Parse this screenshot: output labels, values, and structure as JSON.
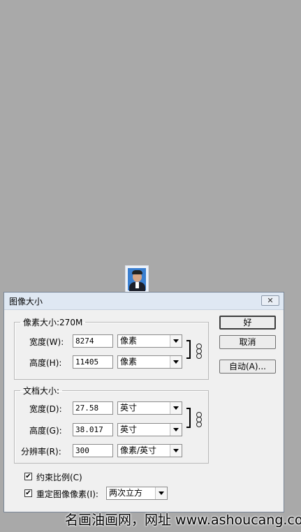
{
  "dialog": {
    "title": "图像大小",
    "close": "✕"
  },
  "pixel_dims": {
    "legend": "像素大小:270M",
    "width_label": "宽度(W):",
    "width_value": "8274",
    "width_unit": "像素",
    "height_label": "高度(H):",
    "height_value": "11405",
    "height_unit": "像素"
  },
  "doc_size": {
    "legend": "文档大小:",
    "width_label": "宽度(D):",
    "width_value": "27.58",
    "width_unit": "英寸",
    "height_label": "高度(G):",
    "height_value": "38.017",
    "height_unit": "英寸",
    "resolution_label": "分辨率(R):",
    "resolution_value": "300",
    "resolution_unit": "像素/英寸"
  },
  "options": {
    "constrain_label": "约束比例(C)",
    "constrain_checked": true,
    "resample_label": "重定图像像素(I):",
    "resample_checked": true,
    "resample_method": "两次立方"
  },
  "buttons": {
    "ok": "好",
    "cancel": "取消",
    "auto": "自动(A)..."
  },
  "watermark": "名画油画网，网址 www.ashoucang.com",
  "icons": {
    "chain_link": "chain-link-icon",
    "dropdown": "chevron-down-icon",
    "check": "checkmark-icon",
    "close": "close-icon"
  }
}
